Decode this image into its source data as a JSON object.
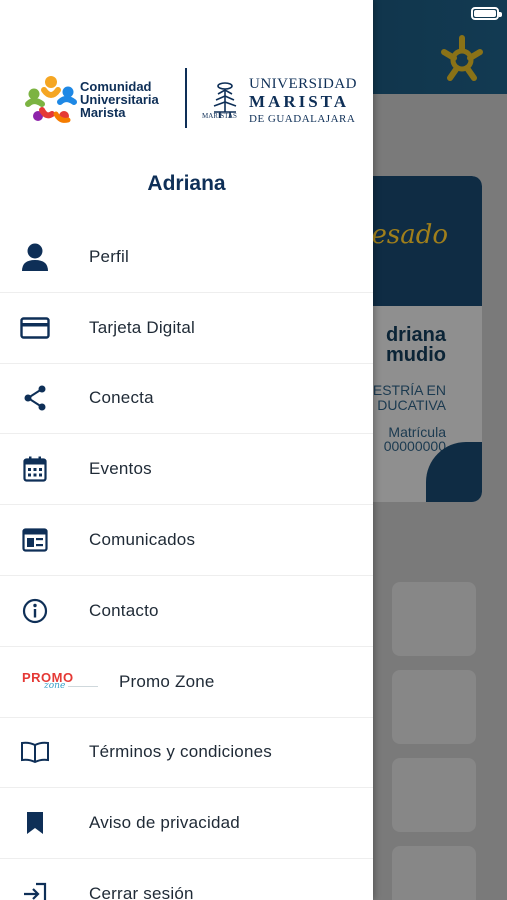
{
  "background": {
    "card": {
      "script_text": "resado",
      "name_line1": "driana",
      "name_line2": "mudio",
      "program_line1": "ESTRÍA EN",
      "program_line2": "DUCATIVA",
      "matricula_label": "Matrícula",
      "matricula_value": "00000000"
    }
  },
  "drawer": {
    "logos": {
      "comunidad": [
        "Comunidad",
        "Universitaria",
        "Marista"
      ],
      "universidad_line1": "UNIVERSIDAD",
      "universidad_line2": "MARISTA",
      "universidad_line3": "DE GUADALAJARA",
      "maristas_small": "MARISTAS"
    },
    "user_name": "Adriana",
    "menu": [
      {
        "label": "Perfil",
        "icon": "person-icon"
      },
      {
        "label": "Tarjeta Digital",
        "icon": "credit-card-icon"
      },
      {
        "label": "Conecta",
        "icon": "share-icon"
      },
      {
        "label": "Eventos",
        "icon": "calendar-icon"
      },
      {
        "label": "Comunicados",
        "icon": "newspaper-icon"
      },
      {
        "label": "Contacto",
        "icon": "info-icon"
      },
      {
        "label": "Promo Zone",
        "icon": "promo-zone-logo",
        "logo_word": "PROMO",
        "logo_sub": "zone"
      },
      {
        "label": "Términos y condiciones",
        "icon": "book-icon"
      },
      {
        "label": "Aviso de privacidad",
        "icon": "bookmark-icon"
      },
      {
        "label": "Cerrar sesión",
        "icon": "logout-icon"
      }
    ]
  },
  "colors": {
    "brand_navy": "#0e2f57",
    "header_dark": "#0d2a3d",
    "icon_color": "#0e2f57",
    "gold": "#c9a227",
    "promo_red": "#e53935"
  }
}
